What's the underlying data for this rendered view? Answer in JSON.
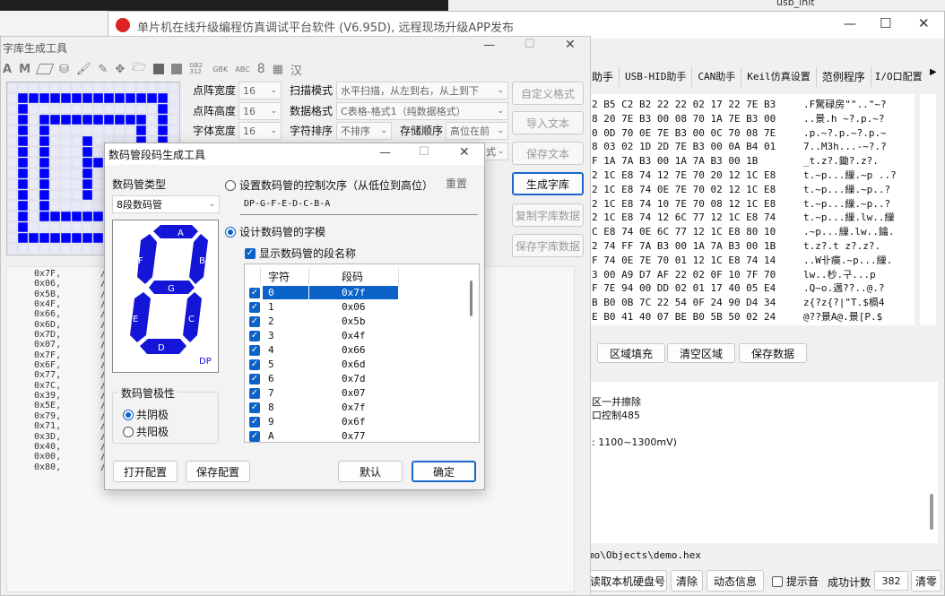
{
  "vs_toolbar": {
    "project": "usb_init"
  },
  "main_window": {
    "title": "单片机在线升级编程仿真调试平台软件 (V6.95D), 远程现场升级APP发布",
    "tabs": [
      "助手",
      "USB-HID助手",
      "CAN助手",
      "Keil仿真设置",
      "范例程序",
      "I/O口配置"
    ],
    "hex_lines": [
      {
        "hex": "2 B5 C2 B2 22 22 02 17 22 7E B3",
        "ascii": ".F驚碌房\"\"..\"~?"
      },
      {
        "hex": "8 20 7E B3 00 08 70 1A 7E B3 00",
        "ascii": "..景.h ~?.p.~?"
      },
      {
        "hex": "0 0D 70 0E 7E B3 00 0C 70 08 7E",
        "ascii": ".p.~?.p.~?.p.~"
      },
      {
        "hex": "8 03 02 1D 2D 7E B3 00 0A B4 01",
        "ascii": "7..M3h...-~?.?"
      },
      {
        "hex": "F 1A 7A B3 00 1A 7A B3 00 1B",
        "ascii": "_t.z?.鋤?.z?."
      },
      {
        "hex": "2 1C E8 74 12 7E 70 20 12 1C E8",
        "ascii": "t.~p...繅.~p ..?"
      },
      {
        "hex": "2 1C E8 74 0E 7E 70 02 12 1C E8",
        "ascii": "t.~p...繅.~p..?"
      },
      {
        "hex": "2 1C E8 74 10 7E 70 08 12 1C E8",
        "ascii": "t.~p...繅.~p..?"
      },
      {
        "hex": "2 1C E8 74 12 6C 77 12 1C E8 74",
        "ascii": "t.~p...繅.lw..繅"
      },
      {
        "hex": "C E8 74 0E 6C 77 12 1C E8 80 10",
        "ascii": ".~p...繅.lw..鑰."
      },
      {
        "hex": "2 74 FF 7A B3 00 1A 7A B3 00 1B",
        "ascii": "t.z?.t  z?.z?."
      },
      {
        "hex": "F 74 0E 7E 70 01 12 1C E8 74 14",
        "ascii": "..W卝瘼.~p...繅."
      },
      {
        "hex": "3 00 A9 D7 AF 22 02 0F 10 7F 70",
        "ascii": "lw..杪.구...p"
      },
      {
        "hex": "F 7E 94 00 DD 02 01 17 40 05 E4",
        "ascii": ".Q~o.邁??..@.?"
      },
      {
        "hex": "B B0 0B 7C 22 54 0F 24 90 D4 34",
        "ascii": "z{?z{?|\"T.$槅4"
      },
      {
        "hex": "E B0 41 40 07 BE B0 5B 50 02 24",
        "ascii": "@??景A@.景[P.$"
      }
    ],
    "region_buttons": [
      "区域填充",
      "清空区域",
      "保存数据"
    ],
    "log_lines": [
      "区一并擦除",
      "口控制485",
      "",
      ": 1100~1300mV)"
    ],
    "path_text": "mo\\Objects\\demo.hex",
    "bottom": {
      "read_disk": "读取本机硬盘号",
      "clear": "清除",
      "dynamic_info": "动态信息",
      "tip_sound": "提示音",
      "success_label": "成功计数",
      "success_count": "382",
      "clear_zero": "清零"
    }
  },
  "font_window": {
    "title": "字库生成工具",
    "toolbar_labels": [
      "A",
      "M",
      "GB2312",
      "GBK",
      "ABC",
      "8",
      "汉"
    ],
    "settings": {
      "dot_width_label": "点阵宽度",
      "dot_width": "16",
      "dot_height_label": "点阵高度",
      "dot_height": "16",
      "font_width_label": "字体宽度",
      "font_width": "16",
      "scan_mode_label": "扫描模式",
      "scan_mode": "水平扫描，从左到右，从上到下",
      "data_format_label": "数据格式",
      "data_format": "C表格-格式1（纯数据格式）",
      "char_order_label": "字符排序",
      "char_order": "不排序",
      "storage_order_label": "存储顺序",
      "storage_order": "高位在前",
      "combo_suffix": "式"
    },
    "side_buttons": [
      "自定义格式",
      "导入文本",
      "保存文本",
      "生成字库",
      "复制字库数据",
      "保存字库数据"
    ],
    "data_lines": [
      "0x7F,",
      "0x06,",
      "0x5B,",
      "0x4F,",
      "0x66,",
      "0x6D,",
      "0x7D,",
      "0x07,",
      "0x7F,",
      "0x6F,",
      "0x77,",
      "0x7C,",
      "0x39,",
      "0x5E,",
      "0x79,",
      "0x71,",
      "0x3D,",
      "0x40,",
      "0x00,",
      "0x80,"
    ],
    "comment_mark": "/*"
  },
  "seg_dialog": {
    "title": "数码管段码生成工具",
    "type_label": "数码管类型",
    "type_value": "8段数码管",
    "segments": {
      "a": "A",
      "b": "B",
      "c": "C",
      "d": "D",
      "e": "E",
      "f": "F",
      "g": "G",
      "dp": "DP"
    },
    "polarity_label": "数码管极性",
    "common_cathode": "共阴极",
    "common_anode": "共阳极",
    "set_order_label": "设置数码管的控制次序（从低位到高位）",
    "reset": "重置",
    "order_value": "DP-G-F-E-D-C-B-A",
    "design_label": "设计数码管的字模",
    "show_names_label": "显示数码管的段名称",
    "table_headers": [
      "字符",
      "段码"
    ],
    "rows": [
      {
        "char": "0",
        "code": "0x7f"
      },
      {
        "char": "1",
        "code": "0x06"
      },
      {
        "char": "2",
        "code": "0x5b"
      },
      {
        "char": "3",
        "code": "0x4f"
      },
      {
        "char": "4",
        "code": "0x66"
      },
      {
        "char": "5",
        "code": "0x6d"
      },
      {
        "char": "6",
        "code": "0x7d"
      },
      {
        "char": "7",
        "code": "0x07"
      },
      {
        "char": "8",
        "code": "0x7f"
      },
      {
        "char": "9",
        "code": "0x6f"
      },
      {
        "char": "A",
        "code": "0x77"
      }
    ],
    "open_config": "打开配置",
    "save_config": "保存配置",
    "default": "默认",
    "ok": "确定"
  },
  "colors": {
    "accent": "#0b62c7",
    "segment": "#1515d8",
    "pixel_on": "#0000ff"
  }
}
